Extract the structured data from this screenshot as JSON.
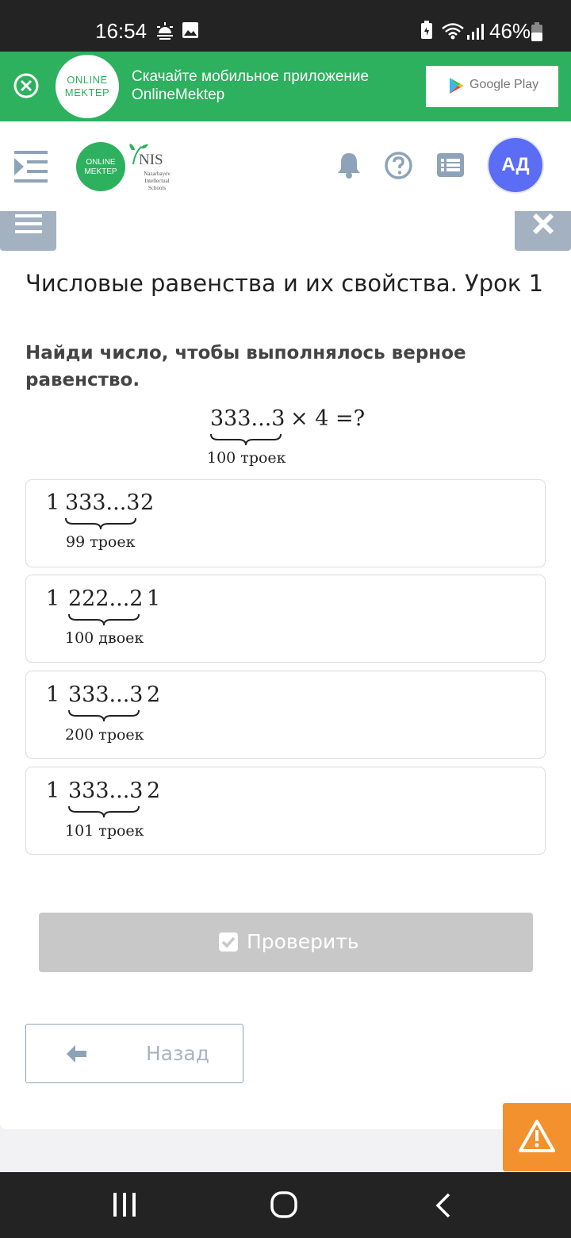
{
  "status_bar": {
    "time": "16:54",
    "battery_text": "46%",
    "icons": [
      "weather-icon",
      "gallery-icon",
      "battery-saver-icon",
      "wifi-icon",
      "signal-icon",
      "battery-icon"
    ]
  },
  "banner": {
    "logo_line1": "ONLINE",
    "logo_line2": "MEKTEP",
    "message_line1": "Скачайте мобильное приложение",
    "message_line2": "OnlineMektep",
    "store_label": "Google Play"
  },
  "header": {
    "logo_line1": "ONLINE",
    "logo_line2": "MEKTEP",
    "partner_name": "NIS",
    "partner_sub1": "Nazarbayev",
    "partner_sub2": "Intellectual",
    "partner_sub3": "Schools",
    "avatar_initials": "АД",
    "icons": [
      "menu-icon",
      "bell-icon",
      "help-icon",
      "list-icon"
    ]
  },
  "lesson": {
    "title": "Числовые равенства и их свойства. Урок 1"
  },
  "question": {
    "text": "Найди число, чтобы выполнялось верное равенство.",
    "expr_number": "333...3",
    "expr_rest": "× 4 =?",
    "expr_caption": "100 троек"
  },
  "options": [
    {
      "prefix": "1",
      "number": "333...3",
      "suffix": "2",
      "caption": "99 троек"
    },
    {
      "prefix": "1",
      "number": "222...2",
      "suffix": "1",
      "caption": "100 двоек"
    },
    {
      "prefix": "1",
      "number": "333...3",
      "suffix": "2",
      "caption": "200 троек"
    },
    {
      "prefix": "1",
      "number": "333...3",
      "suffix": "2",
      "caption": "101 троек"
    }
  ],
  "buttons": {
    "check_label": "Проверить",
    "back_label": "Назад"
  },
  "colors": {
    "brand_green": "#2db15e",
    "avatar": "#5b6cf5",
    "warning": "#f2912d",
    "disabled_button": "#c8c8c8"
  }
}
